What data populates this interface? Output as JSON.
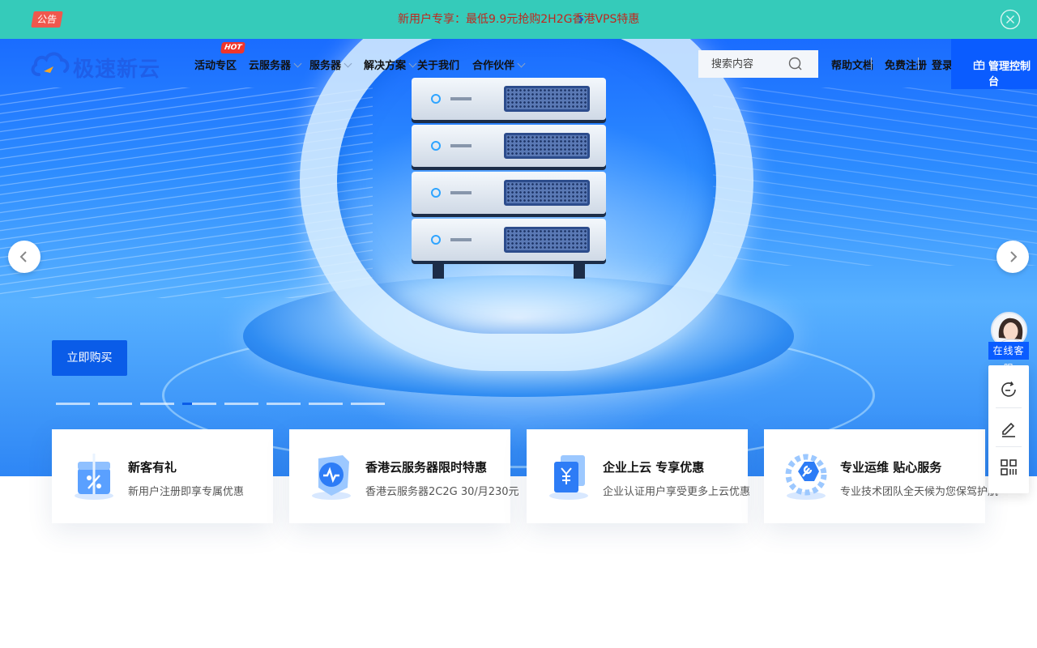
{
  "announcement": {
    "badge": "公告",
    "text": "新用户专享：最低9.9元抢购2H2G香港VPS特惠",
    "chevron_icon": "chevron-right-icon",
    "close_icon": "close-circle-icon"
  },
  "header": {
    "logo_text": "极速新云",
    "hot_badge": "HOT",
    "nav": [
      {
        "label": "活动专区"
      },
      {
        "label": "云服务器"
      },
      {
        "label": "服务器"
      },
      {
        "label": "解决方案"
      },
      {
        "label": "关于我们"
      },
      {
        "label": "合作伙伴"
      }
    ],
    "search_placeholder": "搜索内容",
    "links": {
      "docs": "帮助文档",
      "register": "免费注册",
      "login": "登录"
    },
    "console_label": "管理控制台"
  },
  "hero": {
    "button_label": "立即购买",
    "slide_count": 8,
    "active_slide": 4
  },
  "features": [
    {
      "title": "新客有礼",
      "desc": "新用户注册即享专属优惠",
      "icon": "gift-percent-icon"
    },
    {
      "title": "香港云服务器限时特惠",
      "desc": "香港云服务器2C2G 30/月230元",
      "icon": "shield-pulse-icon"
    },
    {
      "title": "企业上云 专享优惠",
      "desc": "企业认证用户享受更多上云优惠",
      "icon": "yuan-document-icon"
    },
    {
      "title": "专业运维 贴心服务",
      "desc": "专业技术团队全天候为您保驾护航",
      "icon": "wrench-gear-icon"
    }
  ],
  "sidebar": {
    "cs_label": "在线客服",
    "tools": [
      {
        "icon": "refresh-chat-icon"
      },
      {
        "icon": "edit-icon"
      },
      {
        "icon": "qr-code-icon"
      }
    ]
  },
  "colors": {
    "notice_bg": "#35cbba",
    "primary": "#0a5cff",
    "hot": "#f0352b"
  }
}
